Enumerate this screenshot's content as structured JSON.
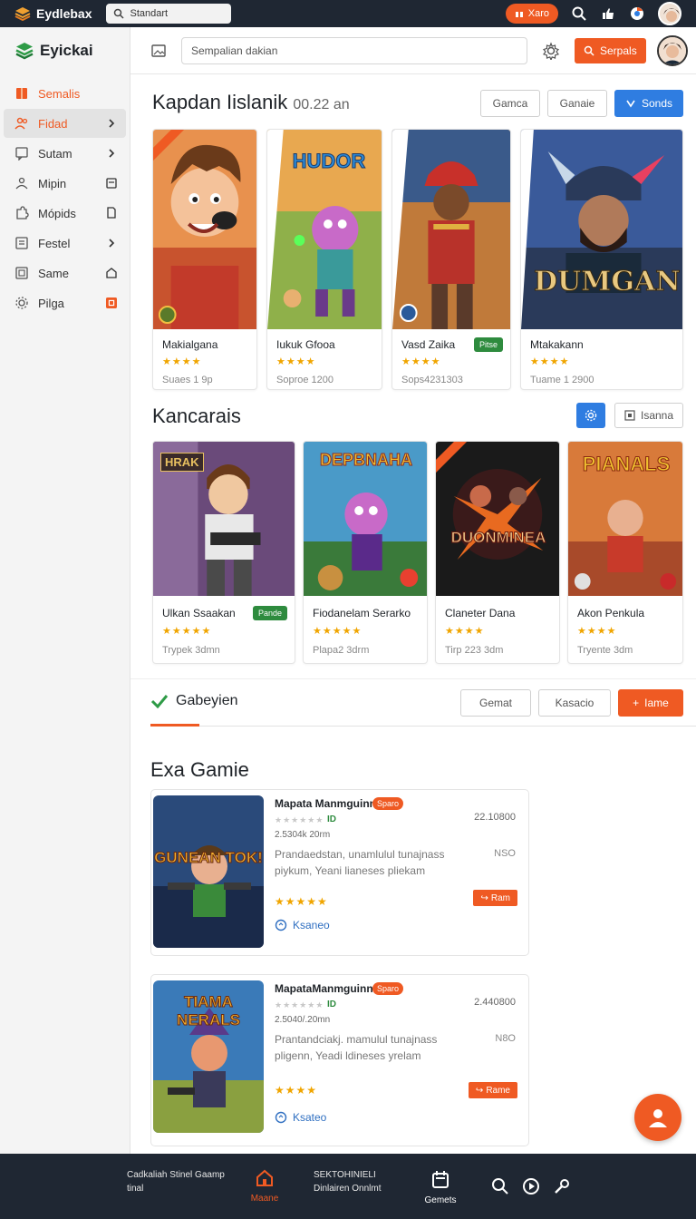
{
  "topbar": {
    "brand": "Eydlebax",
    "search_text": "Standart",
    "promo_label": "Xaro"
  },
  "sidebar": {
    "brand": "Eyickai",
    "items": [
      {
        "label": "Semalis"
      },
      {
        "label": "Fidad"
      },
      {
        "label": "Sutam"
      },
      {
        "label": "Mipin"
      },
      {
        "label": "Mópids"
      },
      {
        "label": "Festel"
      },
      {
        "label": "Same"
      },
      {
        "label": "Pilga"
      }
    ]
  },
  "header": {
    "search_placeholder": "Sempalian dakian",
    "button_label": "Serpals"
  },
  "featured": {
    "title": "Kapdan Iislanik",
    "subtitle": "00.22 an",
    "buttons": [
      "Gamca",
      "Ganaie",
      "Sonds"
    ],
    "cards": [
      {
        "name": "Makialgana",
        "stars": "★★★★",
        "meta": "Suaes 1 9p",
        "badge": ""
      },
      {
        "name": "Iukuk Gfooa",
        "stars": "★★★★",
        "meta": "Soproe 1200",
        "badge": ""
      },
      {
        "name": "Vasd Zaika",
        "stars": "★★★★",
        "meta": "Sops4231303",
        "badge": "Pitse"
      },
      {
        "name": "Mtakakann",
        "stars": "★★★★",
        "meta": "Tuame 1 2900",
        "badge": ""
      }
    ],
    "art_titles": [
      "",
      "HUDOR",
      "",
      "DUMGAN"
    ]
  },
  "kancarais": {
    "title": "Kancarais",
    "button_label": "Isanna",
    "cards": [
      {
        "name": "Ulkan Ssaakan",
        "stars": "★★★★★",
        "meta": "Trypek 3dmn",
        "badge": "Pande"
      },
      {
        "name": "Fiodanelam Serarko",
        "stars": "★★★★★",
        "meta": "Plapa2 3drm",
        "badge": ""
      },
      {
        "name": "Claneter Dana",
        "stars": "★★★★",
        "meta": "Tirp 223 3dm",
        "badge": ""
      },
      {
        "name": "Akon Penkula",
        "stars": "★★★★",
        "meta": "Tryente 3dm",
        "badge": ""
      }
    ],
    "art_titles": [
      "HRAK",
      "DEPBNAHA",
      "DUONMINEA",
      "PIANALS"
    ]
  },
  "tabs": {
    "label": "Gabeyien",
    "buttons": [
      "Gemat",
      "Kasacio",
      "Iame"
    ]
  },
  "exa": {
    "title": "Exa Gamie",
    "items": [
      {
        "title": "Mapata Manmguinn",
        "tag": "Sparo",
        "count": "ID",
        "size": "2.5304k 20rm",
        "desc": "Prandaedstan, unamlulul tunajnass piykum, Yeani lianeses pliekam",
        "num": "22.10800",
        "nso": "NSO",
        "stars": "★★★★★",
        "btn": "Ram",
        "link": "Ksaneo",
        "art": "GUNEAN TOK!"
      },
      {
        "title": "MapataManmguinn",
        "tag": "Sparo",
        "count": "ID",
        "size": "2.5040/.20mn",
        "desc": "Prantandciakj. mamulul tunajnass pligenn, Yeadi ldineses yrelam",
        "num": "2.440800",
        "nso": "N8O",
        "stars": "★★★★",
        "btn": "Rame",
        "link": "Ksateo",
        "art": "TIAMA NERALS"
      }
    ]
  },
  "bottom": {
    "left_text": "Cadkaliah Stinel Gaamp tinal",
    "nav_home": "Maane",
    "middle_text": "SEKTOHINIELI Dinlairen Onnlmt",
    "nav_games": "Gemets"
  },
  "colors": {
    "accent": "#ef5a23",
    "blue": "#2f7de1",
    "dark": "#1f2733",
    "green": "#2e8b3e"
  }
}
